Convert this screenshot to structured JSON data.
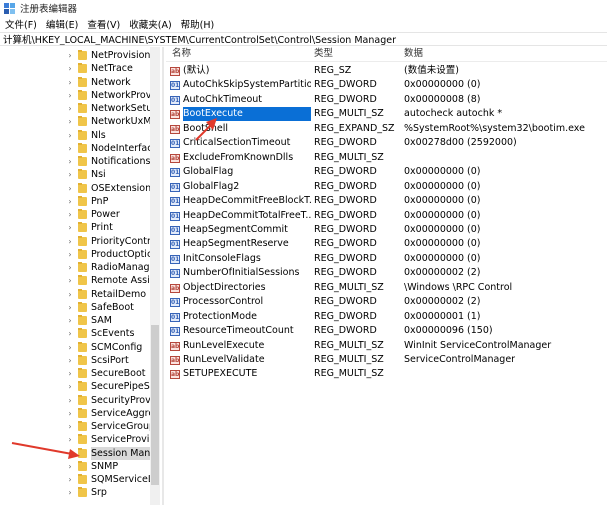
{
  "window": {
    "title": "注册表编辑器",
    "accent_selected": "#0a6fd6"
  },
  "menu": [
    {
      "label": "文件(F)"
    },
    {
      "label": "编辑(E)"
    },
    {
      "label": "查看(V)"
    },
    {
      "label": "收藏夹(A)"
    },
    {
      "label": "帮助(H)"
    }
  ],
  "address": {
    "path": "计算机\\HKEY_LOCAL_MACHINE\\SYSTEM\\CurrentControlSet\\Control\\Session Manager"
  },
  "tree": {
    "items": [
      {
        "label": "NetProvision",
        "selected": false
      },
      {
        "label": "NetTrace",
        "selected": false
      },
      {
        "label": "Network",
        "selected": false
      },
      {
        "label": "NetworkProv",
        "selected": false
      },
      {
        "label": "NetworkSetu",
        "selected": false
      },
      {
        "label": "NetworkUxM",
        "selected": false
      },
      {
        "label": "Nls",
        "selected": false
      },
      {
        "label": "NodeInterfac",
        "selected": false
      },
      {
        "label": "Notifications",
        "selected": false
      },
      {
        "label": "Nsi",
        "selected": false
      },
      {
        "label": "OSExtensionD",
        "selected": false
      },
      {
        "label": "PnP",
        "selected": false
      },
      {
        "label": "Power",
        "selected": false
      },
      {
        "label": "Print",
        "selected": false
      },
      {
        "label": "PriorityContr",
        "selected": false
      },
      {
        "label": "ProductOptic",
        "selected": false
      },
      {
        "label": "RadioManage",
        "selected": false
      },
      {
        "label": "Remote Assis",
        "selected": false
      },
      {
        "label": "RetailDemo",
        "selected": false
      },
      {
        "label": "SafeBoot",
        "selected": false
      },
      {
        "label": "SAM",
        "selected": false
      },
      {
        "label": "ScEvents",
        "selected": false
      },
      {
        "label": "SCMConfig",
        "selected": false
      },
      {
        "label": "ScsiPort",
        "selected": false
      },
      {
        "label": "SecureBoot",
        "selected": false
      },
      {
        "label": "SecurePipeSe",
        "selected": false
      },
      {
        "label": "SecurityProvi",
        "selected": false
      },
      {
        "label": "ServiceAggre",
        "selected": false
      },
      {
        "label": "ServiceGroup",
        "selected": false
      },
      {
        "label": "ServiceProvic",
        "selected": false
      },
      {
        "label": "Session Mana",
        "selected": true
      },
      {
        "label": "SNMP",
        "selected": false
      },
      {
        "label": "SQMServiceL",
        "selected": false
      },
      {
        "label": "Srp",
        "selected": false
      }
    ]
  },
  "list": {
    "headers": {
      "name": "名称",
      "type": "类型",
      "data": "数据"
    },
    "rows": [
      {
        "name": "(默认)",
        "type": "REG_SZ",
        "data": "(数值未设置)",
        "kind": "sz",
        "selected": false
      },
      {
        "name": "AutoChkSkipSystemPartition",
        "type": "REG_DWORD",
        "data": "0x00000000 (0)",
        "kind": "dw",
        "selected": false
      },
      {
        "name": "AutoChkTimeout",
        "type": "REG_DWORD",
        "data": "0x00000008 (8)",
        "kind": "dw",
        "selected": false
      },
      {
        "name": "BootExecute",
        "type": "REG_MULTI_SZ",
        "data": "autocheck autochk *",
        "kind": "sz",
        "selected": true
      },
      {
        "name": "BootShell",
        "type": "REG_EXPAND_SZ",
        "data": "%SystemRoot%\\system32\\bootim.exe",
        "kind": "sz",
        "selected": false
      },
      {
        "name": "CriticalSectionTimeout",
        "type": "REG_DWORD",
        "data": "0x00278d00 (2592000)",
        "kind": "dw",
        "selected": false
      },
      {
        "name": "ExcludeFromKnownDlls",
        "type": "REG_MULTI_SZ",
        "data": "",
        "kind": "sz",
        "selected": false
      },
      {
        "name": "GlobalFlag",
        "type": "REG_DWORD",
        "data": "0x00000000 (0)",
        "kind": "dw",
        "selected": false
      },
      {
        "name": "GlobalFlag2",
        "type": "REG_DWORD",
        "data": "0x00000000 (0)",
        "kind": "dw",
        "selected": false
      },
      {
        "name": "HeapDeCommitFreeBlockT...",
        "type": "REG_DWORD",
        "data": "0x00000000 (0)",
        "kind": "dw",
        "selected": false
      },
      {
        "name": "HeapDeCommitTotalFreeT...",
        "type": "REG_DWORD",
        "data": "0x00000000 (0)",
        "kind": "dw",
        "selected": false
      },
      {
        "name": "HeapSegmentCommit",
        "type": "REG_DWORD",
        "data": "0x00000000 (0)",
        "kind": "dw",
        "selected": false
      },
      {
        "name": "HeapSegmentReserve",
        "type": "REG_DWORD",
        "data": "0x00000000 (0)",
        "kind": "dw",
        "selected": false
      },
      {
        "name": "InitConsoleFlags",
        "type": "REG_DWORD",
        "data": "0x00000000 (0)",
        "kind": "dw",
        "selected": false
      },
      {
        "name": "NumberOfInitialSessions",
        "type": "REG_DWORD",
        "data": "0x00000002 (2)",
        "kind": "dw",
        "selected": false
      },
      {
        "name": "ObjectDirectories",
        "type": "REG_MULTI_SZ",
        "data": "\\Windows \\RPC Control",
        "kind": "sz",
        "selected": false
      },
      {
        "name": "ProcessorControl",
        "type": "REG_DWORD",
        "data": "0x00000002 (2)",
        "kind": "dw",
        "selected": false
      },
      {
        "name": "ProtectionMode",
        "type": "REG_DWORD",
        "data": "0x00000001 (1)",
        "kind": "dw",
        "selected": false
      },
      {
        "name": "ResourceTimeoutCount",
        "type": "REG_DWORD",
        "data": "0x00000096 (150)",
        "kind": "dw",
        "selected": false
      },
      {
        "name": "RunLevelExecute",
        "type": "REG_MULTI_SZ",
        "data": "WinInit ServiceControlManager",
        "kind": "sz",
        "selected": false
      },
      {
        "name": "RunLevelValidate",
        "type": "REG_MULTI_SZ",
        "data": "ServiceControlManager",
        "kind": "sz",
        "selected": false
      },
      {
        "name": "SETUPEXECUTE",
        "type": "REG_MULTI_SZ",
        "data": "",
        "kind": "sz",
        "selected": false
      }
    ]
  },
  "annotations": {
    "arrow_color": "#e0392b"
  }
}
